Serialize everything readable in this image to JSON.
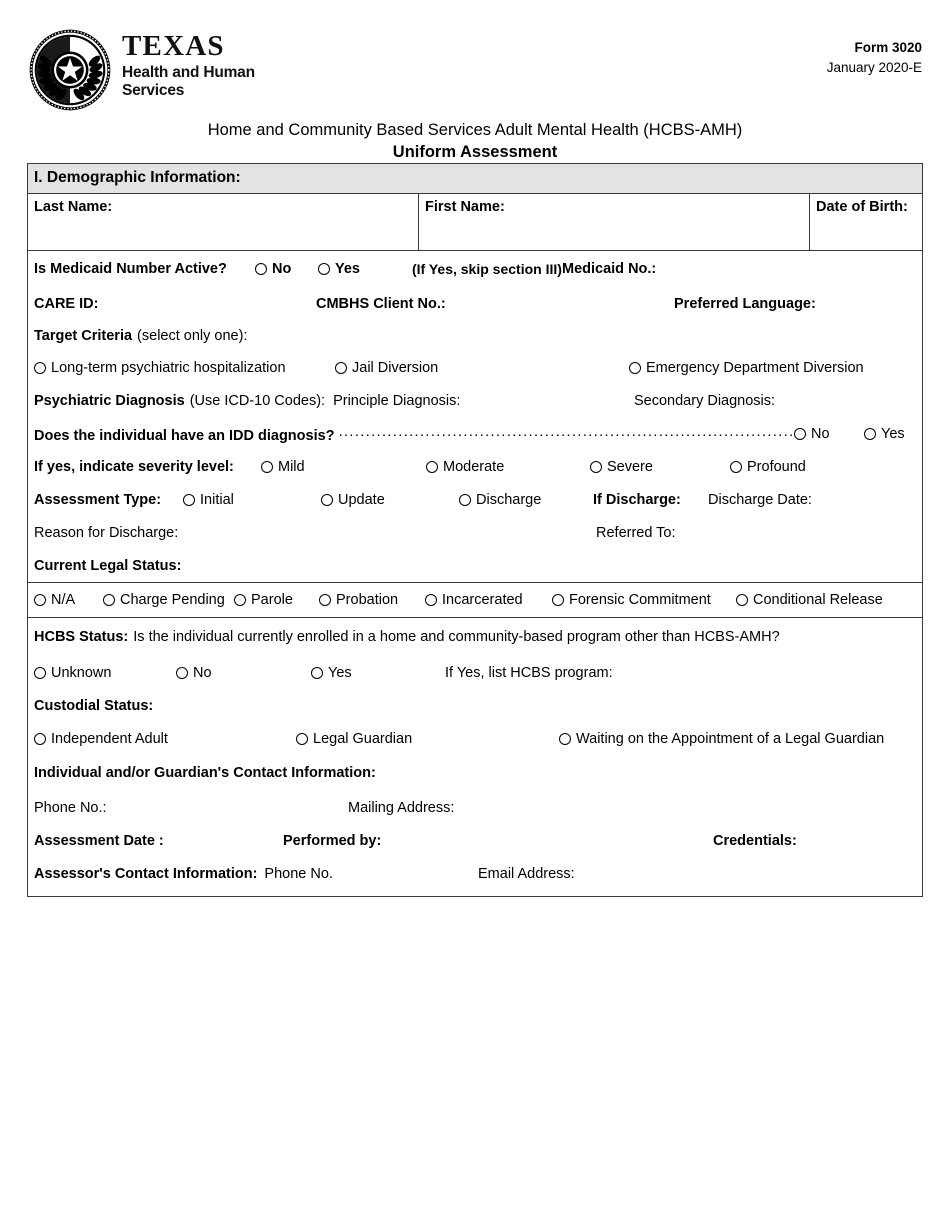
{
  "header": {
    "logo": {
      "texas": "TEXAS",
      "line1": "Health and Human",
      "line2": "Services",
      "seal_name": "texas-hhs-seal"
    },
    "form_number": "Form 3020",
    "form_revision": "January 2020-E"
  },
  "title": {
    "line1": "Home and Community Based Services Adult Mental Health (HCBS-AMH)",
    "line2": "Uniform Assessment"
  },
  "section": {
    "heading": "I. Demographic Information:"
  },
  "name_row": {
    "last_name": "Last Name:",
    "first_name": "First Name:",
    "date_of_birth": "Date of Birth:"
  },
  "medicaid": {
    "question": "Is Medicaid Number Active?",
    "options": [
      "No",
      "Yes"
    ],
    "note": "(If Yes, skip section III)",
    "number_label": "Medicaid No.:"
  },
  "ids": {
    "care_id": "CARE ID:",
    "cmbhs_client_no": "CMBHS Client No.:",
    "preferred_language": "Preferred Language:"
  },
  "target_criteria": {
    "label": "Target Criteria",
    "hint": "(select only one):",
    "options": [
      "Long-term psychiatric hospitalization",
      "Jail Diversion",
      "Emergency Department Diversion"
    ]
  },
  "diagnosis": {
    "label": "Psychiatric Diagnosis",
    "hint": "(Use ICD-10 Codes):",
    "principle": "Principle Diagnosis:",
    "secondary": "Secondary Diagnosis:"
  },
  "idd": {
    "question": "Does the individual have an IDD diagnosis?",
    "leader": "...............................................................................................................",
    "options": [
      "No",
      "Yes"
    ],
    "severity_label": "If yes, indicate severity level:",
    "severity_options": [
      "Mild",
      "Moderate",
      "Severe",
      "Profound"
    ]
  },
  "assessment_type": {
    "label": "Assessment Type:",
    "options": [
      "Initial",
      "Update",
      "Discharge"
    ],
    "if_discharge": "If Discharge:",
    "discharge_date": "Discharge Date:",
    "reason_for_discharge": "Reason for Discharge:",
    "referred_to": "Referred To:"
  },
  "legal_status": {
    "label": "Current Legal Status:",
    "options": [
      "N/A",
      "Charge Pending",
      "Parole",
      "Probation",
      "Incarcerated",
      "Forensic Commitment",
      "Conditional Release"
    ]
  },
  "hcbs_status": {
    "label": "HCBS Status:",
    "question": "Is the individual currently enrolled in a home and community-based program other than HCBS-AMH?",
    "options": [
      "Unknown",
      "No",
      "Yes"
    ],
    "if_yes": "If Yes, list HCBS program:"
  },
  "custodial_status": {
    "label": "Custodial Status:",
    "options": [
      "Independent Adult",
      "Legal Guardian",
      "Waiting on the Appointment of a Legal Guardian"
    ]
  },
  "contact": {
    "heading": "Individual and/or Guardian's Contact Information:",
    "phone": "Phone No.:",
    "mailing_address": "Mailing Address:",
    "assessment_date": "Assessment Date :",
    "performed_by": "Performed by:",
    "credentials": "Credentials:",
    "assessor_heading": "Assessor's Contact Information:",
    "assessor_phone": "Phone No.",
    "assessor_email": "Email Address:"
  },
  "colors": {
    "section_header_bg": "#e3e3e3",
    "border": "#3a3a3a",
    "text": "#000000"
  }
}
